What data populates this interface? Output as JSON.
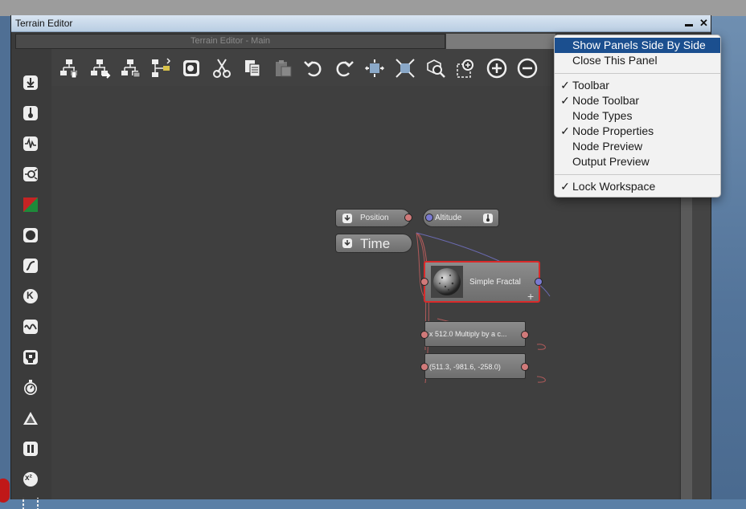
{
  "window": {
    "title": "Terrain Editor",
    "minimize_glyph": "▬",
    "close_glyph": "✕"
  },
  "tabs": {
    "main": "Terrain Editor - Main"
  },
  "palette_icons": [
    "position-node-icon",
    "altitude-node-icon",
    "waveform-icon",
    "connector-icon",
    "color-icon",
    "circle-icon",
    "curve-icon",
    "k-constant-icon",
    "wave-icon",
    "mask-icon",
    "timer-icon",
    "triangle-icon",
    "pause-icon",
    "power-icon",
    "frame-icon"
  ],
  "palette_power_text": "x²",
  "palette_k_text": "K",
  "toolbar_icons": [
    "hierarchy-add-icon",
    "hierarchy-right-icon",
    "hierarchy-left-icon",
    "hierarchy-branch-icon",
    "snapshot-icon",
    "cut-icon",
    "copy-icon",
    "paste-icon",
    "undo-icon",
    "redo-icon",
    "fit-selected-icon",
    "fit-all-icon",
    "inspect-icon",
    "zoom-region-icon",
    "zoom-in-icon",
    "zoom-out-icon"
  ],
  "nodes": {
    "position": {
      "label": "Position"
    },
    "time": {
      "label": "Time"
    },
    "altitude": {
      "label": "Altitude"
    },
    "simple_fractal": {
      "label": "Simple Fractal"
    },
    "multiply": {
      "label": "x 512.0  Multiply by a c..."
    },
    "vector": {
      "label": "(511.3, -981.6, -258.0)"
    }
  },
  "context_menu": {
    "items": [
      {
        "label": "Show Panels Side By Side",
        "checked": false,
        "selected": true
      },
      {
        "label": "Close This Panel",
        "checked": false,
        "selected": false
      },
      {
        "label": "Toolbar",
        "checked": true,
        "selected": false
      },
      {
        "label": "Node Toolbar",
        "checked": true,
        "selected": false
      },
      {
        "label": "Node Types",
        "checked": false,
        "selected": false
      },
      {
        "label": "Node Properties",
        "checked": true,
        "selected": false
      },
      {
        "label": "Node Preview",
        "checked": false,
        "selected": false
      },
      {
        "label": "Output Preview",
        "checked": false,
        "selected": false
      },
      {
        "label": "Lock Workspace",
        "checked": true,
        "selected": false
      }
    ],
    "check_glyph": "✓"
  },
  "colors": {
    "selected_node_border": "#d92a2a",
    "menu_highlight": "#1b4f8f",
    "output_port": "#d07a7a",
    "input_port": "#7a7ad0"
  }
}
